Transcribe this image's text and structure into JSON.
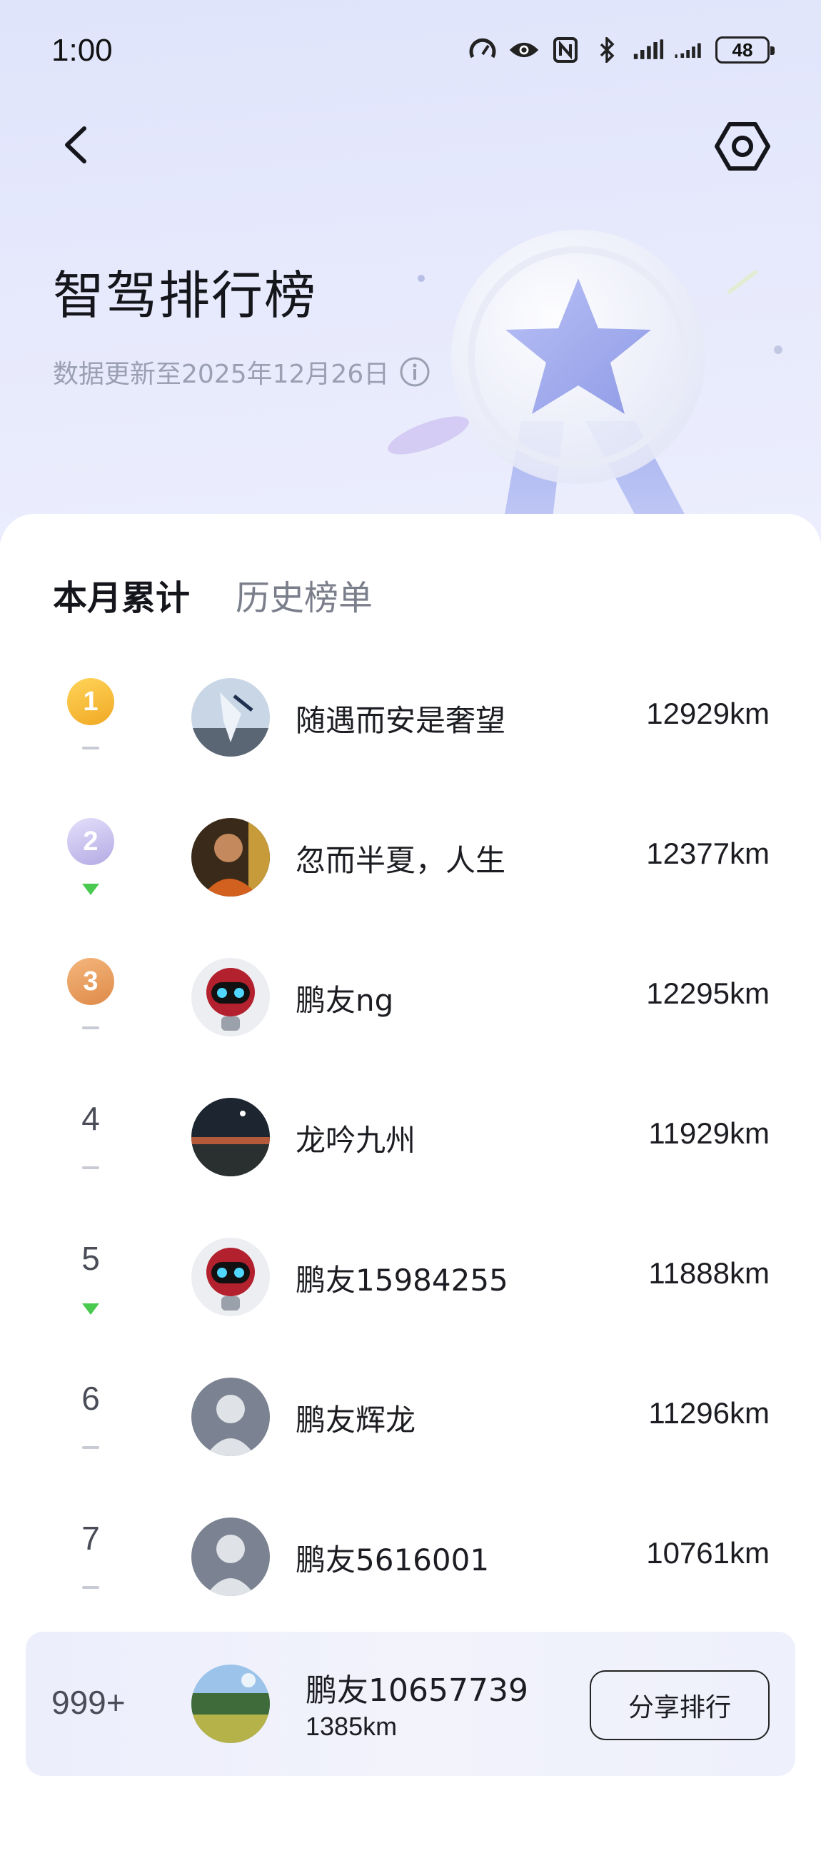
{
  "status_bar": {
    "time": "1:00",
    "battery": "48",
    "icons": [
      "speed-icon",
      "eye-icon",
      "nfc-icon",
      "bluetooth-icon",
      "signal-icon",
      "signal-2-icon"
    ]
  },
  "header": {
    "title": "智驾排行榜",
    "subtitle": "数据更新至2025年12月26日"
  },
  "tabs": [
    {
      "label": "本月累计",
      "active": true
    },
    {
      "label": "历史榜单",
      "active": false
    }
  ],
  "leaderboard": [
    {
      "rank": "1",
      "name": "随遇而安是奢望",
      "distance": "12929km",
      "trend": "flat",
      "badge_color": "#f2b230"
    },
    {
      "rank": "2",
      "name": "忽而半夏，人生",
      "distance": "12377km",
      "trend": "down",
      "badge_color": "#bdb6e8"
    },
    {
      "rank": "3",
      "name": "鹏友ng",
      "distance": "12295km",
      "trend": "flat",
      "badge_color": "#e89a5a"
    },
    {
      "rank": "4",
      "name": "龙吟九州",
      "distance": "11929km",
      "trend": "flat"
    },
    {
      "rank": "5",
      "name": "鹏友15984255",
      "distance": "11888km",
      "trend": "down"
    },
    {
      "rank": "6",
      "name": "鹏友辉龙",
      "distance": "11296km",
      "trend": "flat"
    },
    {
      "rank": "7",
      "name": "鹏友5616001",
      "distance": "10761km",
      "trend": "flat"
    }
  ],
  "my_rank": {
    "rank": "999+",
    "name": "鹏友10657739",
    "distance": "1385km",
    "share_label": "分享排行"
  }
}
